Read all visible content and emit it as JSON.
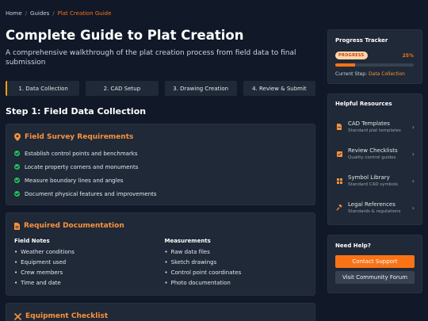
{
  "breadcrumb": {
    "items": [
      "Home",
      "Guides"
    ],
    "current": "Plat Creation Guide"
  },
  "page": {
    "title": "Complete Guide to Plat Creation",
    "subtitle": "A comprehensive walkthrough of the plat creation process from field data to final submission"
  },
  "tabs": [
    "1. Data Collection",
    "2. CAD Setup",
    "3. Drawing Creation",
    "4. Review & Submit"
  ],
  "step_title": "Step 1: Field Data Collection",
  "survey": {
    "heading": "Field Survey Requirements",
    "items": [
      "Establish control points and benchmarks",
      "Locate property corners and monuments",
      "Measure boundary lines and angles",
      "Document physical features and improvements"
    ]
  },
  "documentation": {
    "heading": "Required Documentation",
    "columns": [
      {
        "title": "Field Notes",
        "items": [
          "Weather conditions",
          "Equipment used",
          "Crew members",
          "Time and date"
        ]
      },
      {
        "title": "Measurements",
        "items": [
          "Raw data files",
          "Sketch drawings",
          "Control point coordinates",
          "Photo documentation"
        ]
      }
    ]
  },
  "equipment": {
    "heading": "Equipment Checklist"
  },
  "progress": {
    "title": "Progress Tracker",
    "badge": "PROGRESS",
    "percent_label": "25%",
    "percent": 25,
    "current_label": "Current Step:",
    "current_value": "Data Collection"
  },
  "resources": {
    "title": "Helpful Resources",
    "items": [
      {
        "name": "CAD Templates",
        "desc": "Standard plat templates",
        "icon": "file-icon"
      },
      {
        "name": "Review Checklists",
        "desc": "Quality control guides",
        "icon": "checklist-icon"
      },
      {
        "name": "Symbol Library",
        "desc": "Standard CAD symbols",
        "icon": "grid-icon"
      },
      {
        "name": "Legal References",
        "desc": "Standards & regulations",
        "icon": "gavel-icon"
      }
    ]
  },
  "help": {
    "title": "Need Help?",
    "primary": "Contact Support",
    "secondary": "Visit Community Forum"
  },
  "colors": {
    "accent": "#f97316",
    "background": "#111827",
    "card": "#1f2937",
    "success": "#22c55e"
  }
}
